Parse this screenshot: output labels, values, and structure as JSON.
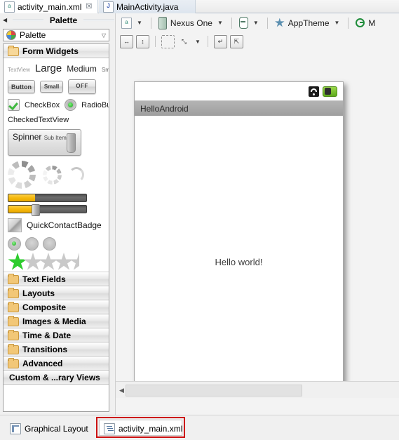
{
  "editor_tabs": [
    {
      "label": "activity_main.xml",
      "icon": "xml-file-icon",
      "icon_glyph": "a",
      "active": true,
      "close": "☒"
    },
    {
      "label": "MainActivity.java",
      "icon": "java-file-icon",
      "icon_glyph": "J",
      "active": false
    }
  ],
  "palette": {
    "title": "Palette",
    "selector_label": "Palette",
    "selector_icon": "palette-swatch-icon",
    "categories": [
      {
        "label": "Form Widgets",
        "expanded": true,
        "items": {
          "textviews": [
            {
              "label": "TextView",
              "style": "tv-textview"
            },
            {
              "label": "Large",
              "style": "tv-large"
            },
            {
              "label": "Medium",
              "style": "tv-medium"
            },
            {
              "label": "Small",
              "style": "tv-small"
            }
          ],
          "buttons": [
            {
              "label": "Button",
              "style": "btn-button"
            },
            {
              "label": "Small",
              "style": "btn-small"
            },
            {
              "label": "OFF",
              "style": "btn-off"
            }
          ],
          "checkbox_label": "CheckBox",
          "radiobutton_label": "RadioButton",
          "checkedtextview_label": "CheckedTextView",
          "spinner_label": "Spinner",
          "spinner_sublabel": "Sub Item",
          "quickcontactbadge_label": "QuickContactBadge"
        }
      },
      {
        "label": "Text Fields",
        "expanded": false
      },
      {
        "label": "Layouts",
        "expanded": false
      },
      {
        "label": "Composite",
        "expanded": false
      },
      {
        "label": "Images & Media",
        "expanded": false
      },
      {
        "label": "Time & Date",
        "expanded": false
      },
      {
        "label": "Transitions",
        "expanded": false
      },
      {
        "label": "Advanced",
        "expanded": false
      },
      {
        "label": "Custom & ...rary Views",
        "expanded": false,
        "no_folder": true
      }
    ]
  },
  "toolbar": {
    "config_label": "",
    "device_label": "Nexus One",
    "orientation_label": "",
    "theme_label": "AppTheme",
    "activity_label": "M",
    "row2_buttons": [
      {
        "name": "match-width-button",
        "glyph": "↔"
      },
      {
        "name": "match-height-button",
        "glyph": "↕"
      },
      {
        "name": "show-included-button",
        "glyph": "░"
      },
      {
        "name": "zoom-fit-button",
        "glyph": "⤡"
      },
      {
        "name": "zoom-dropdown-caret",
        "glyph": "▾"
      },
      {
        "name": "refresh-layout-button",
        "glyph": "↵"
      },
      {
        "name": "toggle-render-button",
        "glyph": "⇱"
      }
    ]
  },
  "preview": {
    "app_title": "HelloAndroid",
    "body_text": "Hello world!",
    "status_icons": [
      {
        "name": "wifi-icon"
      },
      {
        "name": "battery-icon"
      }
    ]
  },
  "bottom_tabs": [
    {
      "label": "Graphical Layout",
      "icon": "graphical-layout-icon",
      "active": false
    },
    {
      "label": "activity_main.xml",
      "icon": "xml-tree-icon",
      "active": true,
      "highlighted": true
    }
  ],
  "colors": {
    "highlight_border": "#cc1111",
    "accent_green": "#2ecc2e",
    "progress_fill": "#f5b90d",
    "titlebar_gray": "#9e9e9e"
  }
}
